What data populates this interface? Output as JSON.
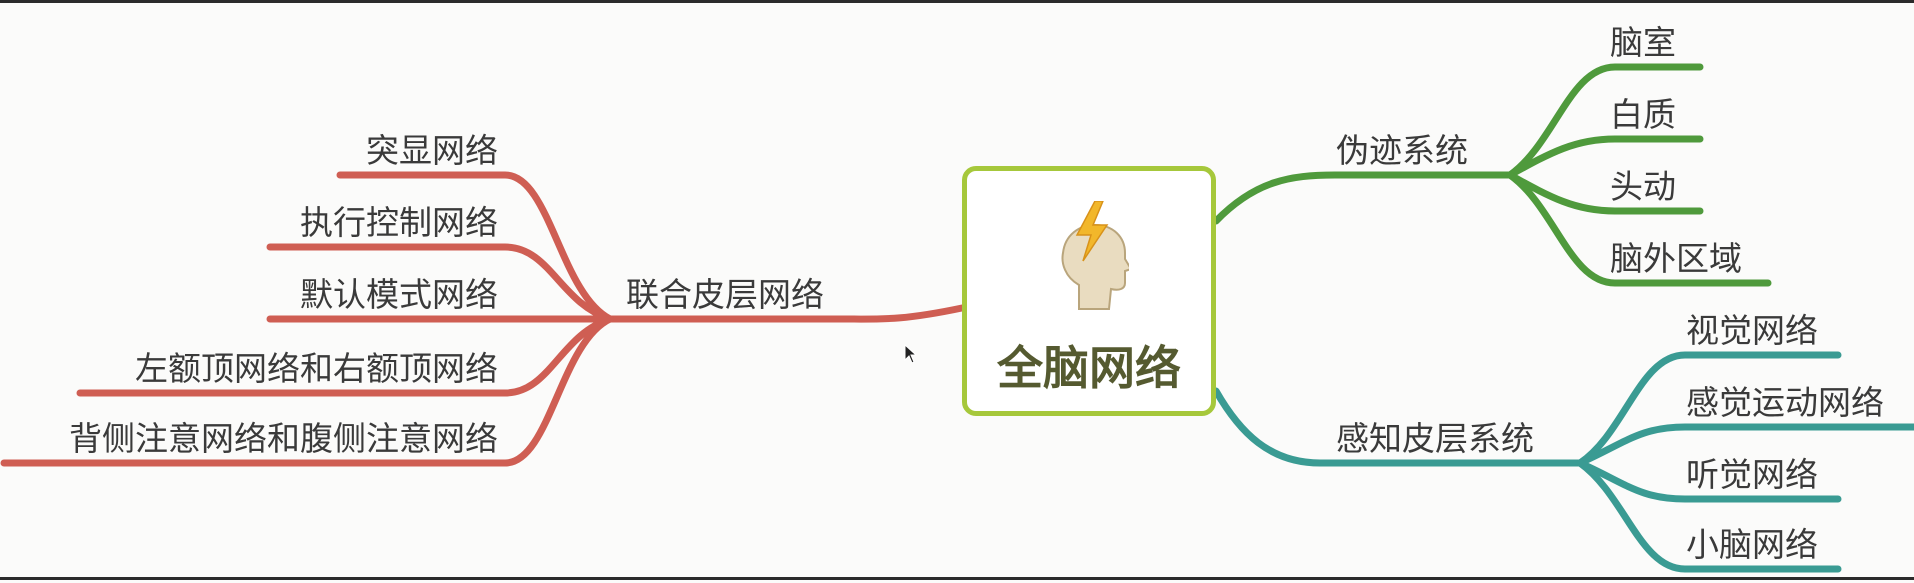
{
  "central": {
    "title": "全脑网络",
    "icon": "head-lightning-icon"
  },
  "branches": {
    "artifact": {
      "label": "伪迹系统",
      "color": "#4f9a3c",
      "children": [
        "脑室",
        "白质",
        "头动",
        "脑外区域"
      ]
    },
    "sensory": {
      "label": "感知皮层系统",
      "color": "#3a9b93",
      "children": [
        "视觉网络",
        "感觉运动网络",
        "听觉网络",
        "小脑网络"
      ]
    },
    "association": {
      "label": "联合皮层网络",
      "color": "#cf5e53",
      "children": [
        "突显网络",
        "执行控制网络",
        "默认模式网络",
        "左额顶网络和右额顶网络",
        "背侧注意网络和腹侧注意网络"
      ]
    }
  },
  "colors": {
    "central_border": "#a6c83b",
    "central_text": "#555a30",
    "icon_bolt": "#f2b72b",
    "icon_head": "#e9dcc0"
  }
}
